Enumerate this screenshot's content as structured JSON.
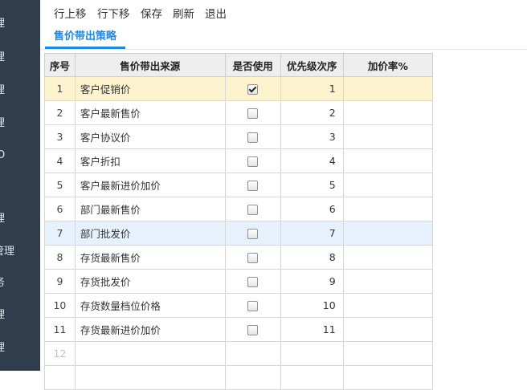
{
  "sidebar": {
    "items": [
      {
        "label": "理"
      },
      {
        "label": "理"
      },
      {
        "label": "理"
      },
      {
        "label": "理"
      },
      {
        "label": "O"
      },
      {
        "label": "理"
      },
      {
        "label": "管理"
      },
      {
        "label": "务"
      },
      {
        "label": "理"
      },
      {
        "label": "理"
      }
    ]
  },
  "toolbar": {
    "move_up": "行上移",
    "move_down": "行下移",
    "save": "保存",
    "refresh": "刷新",
    "exit": "退出"
  },
  "tabs": [
    {
      "label": "售价带出策略",
      "active": true
    }
  ],
  "table": {
    "columns": [
      "序号",
      "售价带出来源",
      "是否使用",
      "优先级次序",
      "加价率%"
    ],
    "rows": [
      {
        "no": "1",
        "source": "客户促销价",
        "checked": true,
        "priority": "1",
        "markup": ""
      },
      {
        "no": "2",
        "source": "客户最新售价",
        "checked": false,
        "priority": "2",
        "markup": ""
      },
      {
        "no": "3",
        "source": "客户协议价",
        "checked": false,
        "priority": "3",
        "markup": ""
      },
      {
        "no": "4",
        "source": "客户折扣",
        "checked": false,
        "priority": "4",
        "markup": ""
      },
      {
        "no": "5",
        "source": "客户最新进价加价",
        "checked": false,
        "priority": "5",
        "markup": ""
      },
      {
        "no": "6",
        "source": "部门最新售价",
        "checked": false,
        "priority": "6",
        "markup": ""
      },
      {
        "no": "7",
        "source": "部门批发价",
        "checked": false,
        "priority": "7",
        "markup": ""
      },
      {
        "no": "8",
        "source": "存货最新售价",
        "checked": false,
        "priority": "8",
        "markup": ""
      },
      {
        "no": "9",
        "source": "存货批发价",
        "checked": false,
        "priority": "9",
        "markup": ""
      },
      {
        "no": "10",
        "source": "存货数量档位价格",
        "checked": false,
        "priority": "10",
        "markup": ""
      },
      {
        "no": "11",
        "source": "存货最新进价加价",
        "checked": false,
        "priority": "11",
        "markup": ""
      }
    ],
    "empty_row_no": "12",
    "selected_row": "1",
    "hover_row": "7"
  },
  "colors": {
    "sidebar_bg": "#2f3d4c",
    "accent": "#1e88e5",
    "selected_row_bg": "#fdf4cf",
    "hover_row_bg": "#e6f1fc",
    "header_bg": "#eeeeee"
  }
}
